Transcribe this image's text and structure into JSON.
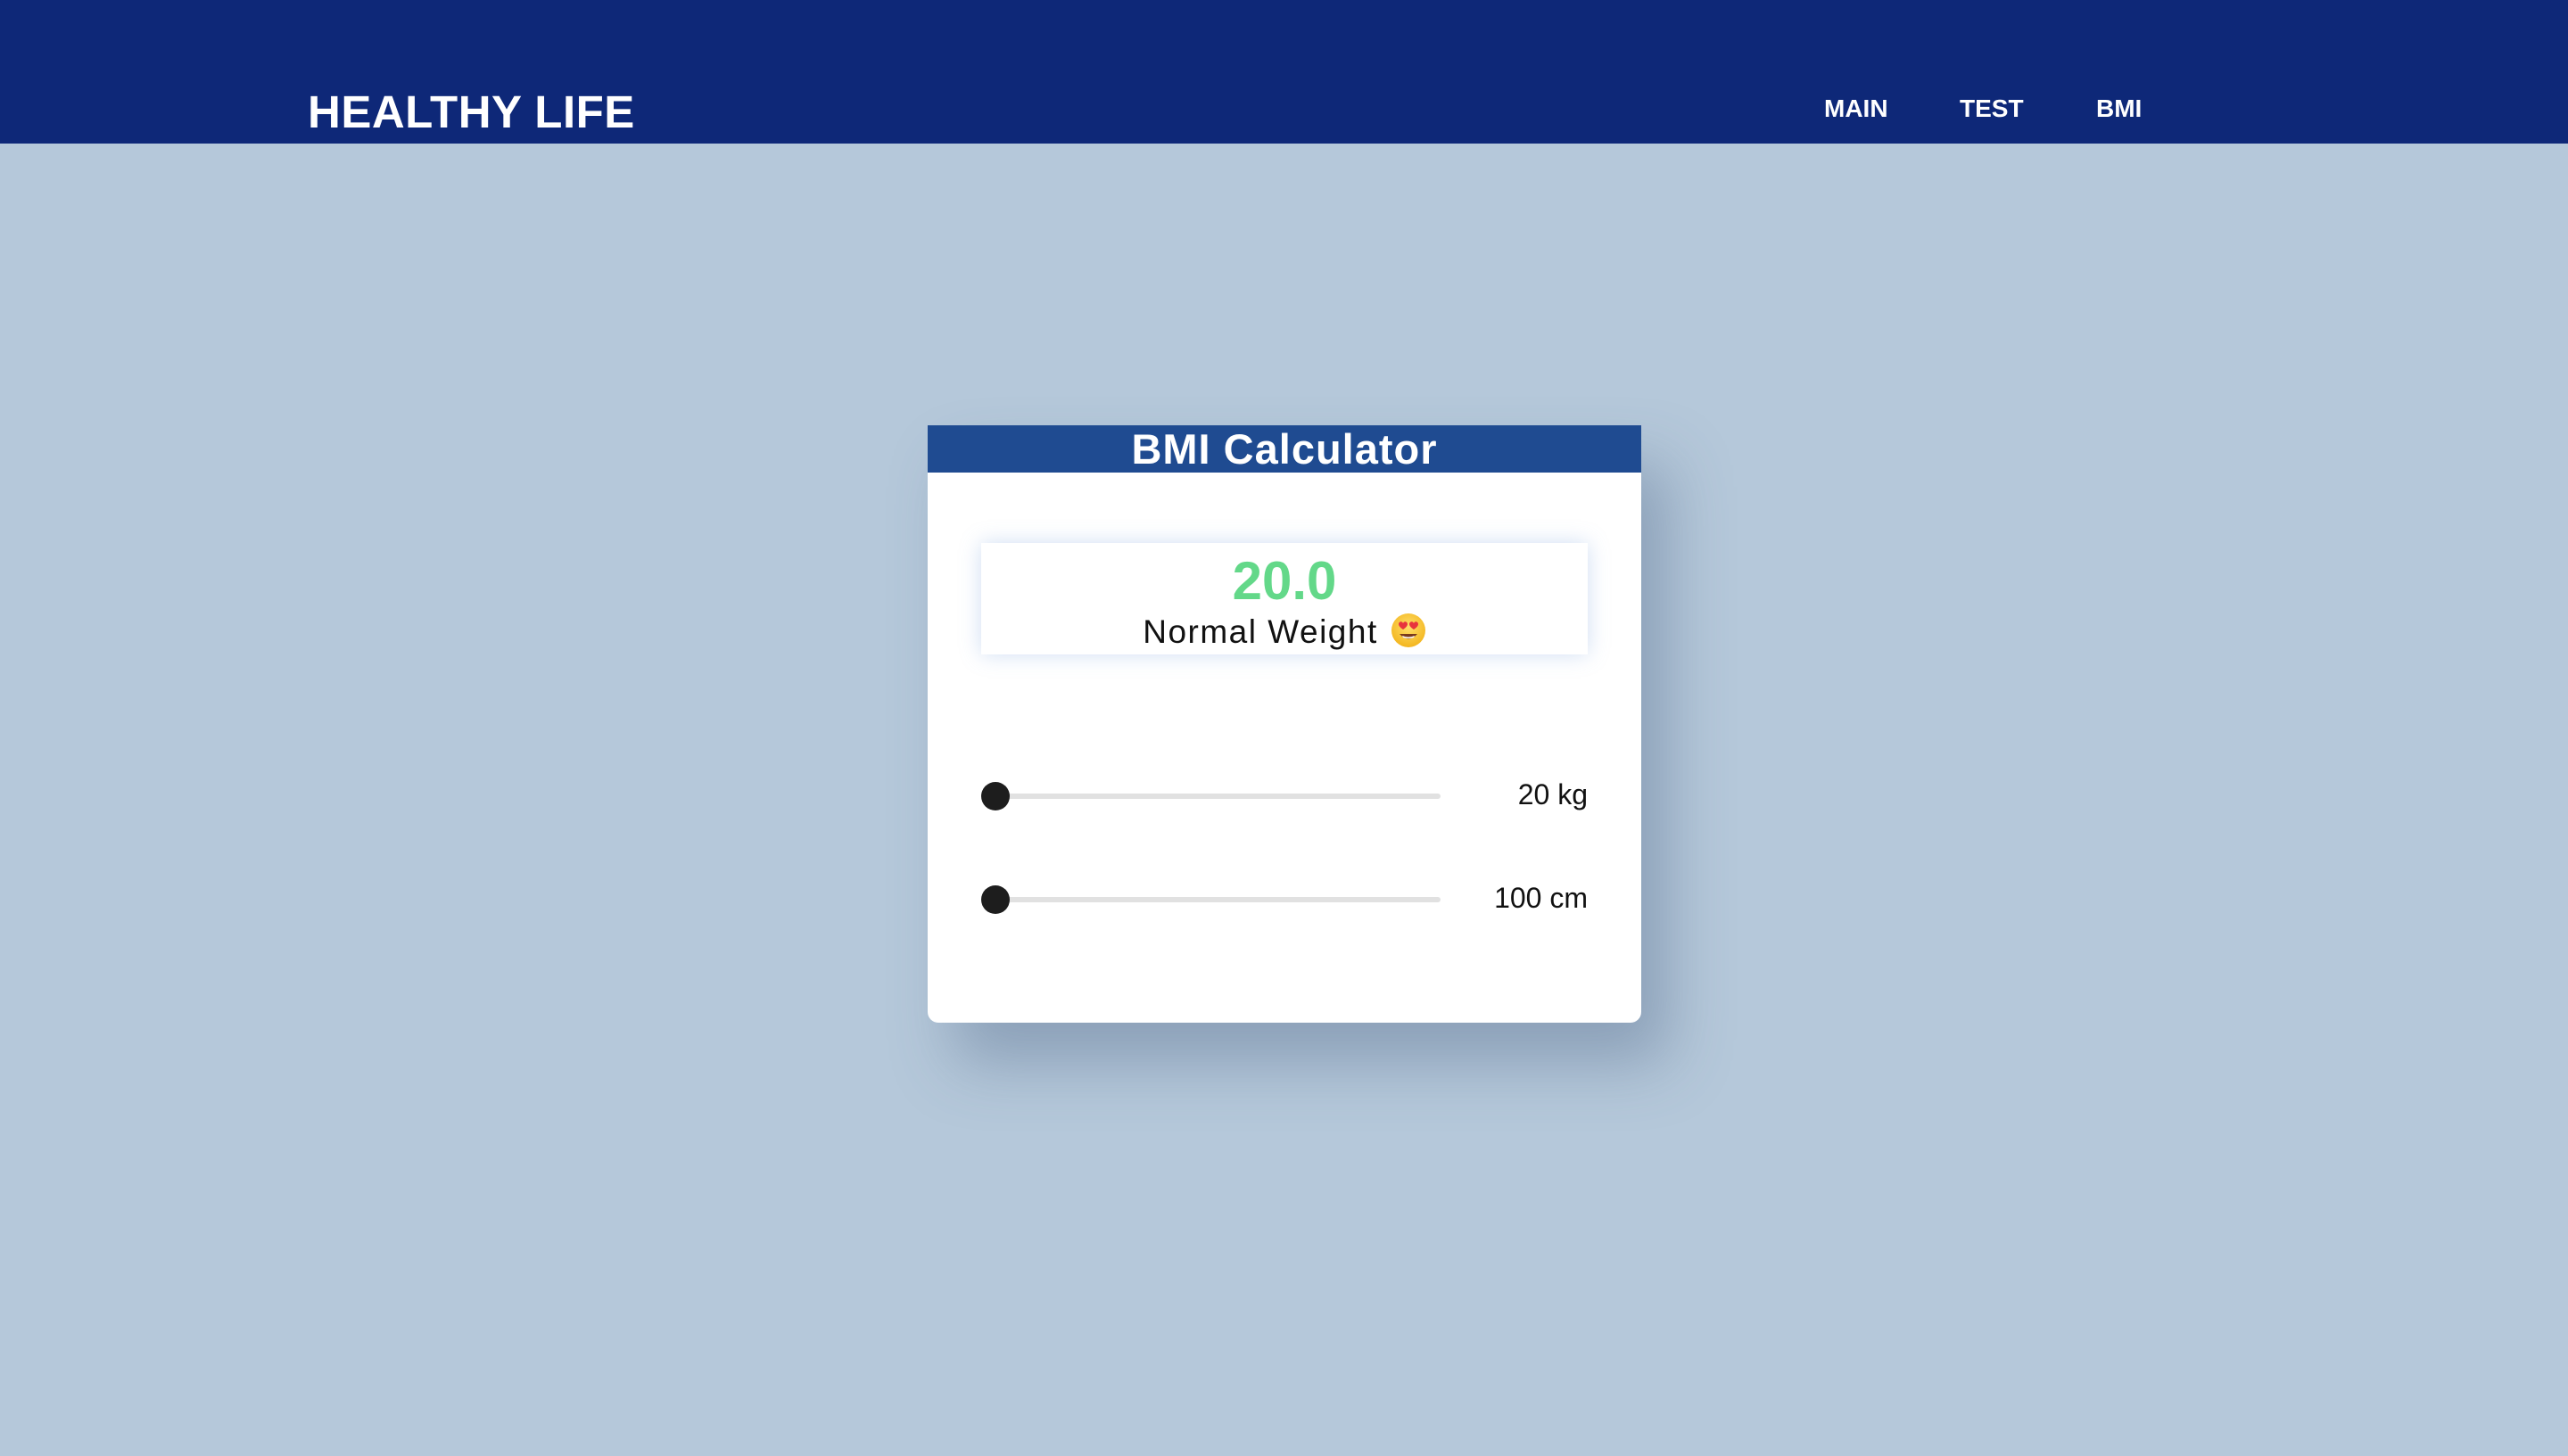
{
  "navbar": {
    "brand": "HEALTHY LIFE",
    "links": [
      {
        "label": "MAIN"
      },
      {
        "label": "TEST"
      },
      {
        "label": "BMI"
      }
    ]
  },
  "calculator": {
    "title": "BMI Calculator",
    "result": {
      "value": "20.0",
      "category": "Normal Weight",
      "emoji": "heart-eyes-face-icon",
      "value_color": "#63d889"
    },
    "weight_slider": {
      "value_text": "20 kg",
      "position_fraction": 0.0
    },
    "height_slider": {
      "value_text": "100 cm",
      "position_fraction": 0.0
    }
  },
  "colors": {
    "navbar_bg": "#0e2878",
    "page_bg": "#b5c8da",
    "card_header_bg": "#1f4b91",
    "accent_green": "#63d889"
  }
}
